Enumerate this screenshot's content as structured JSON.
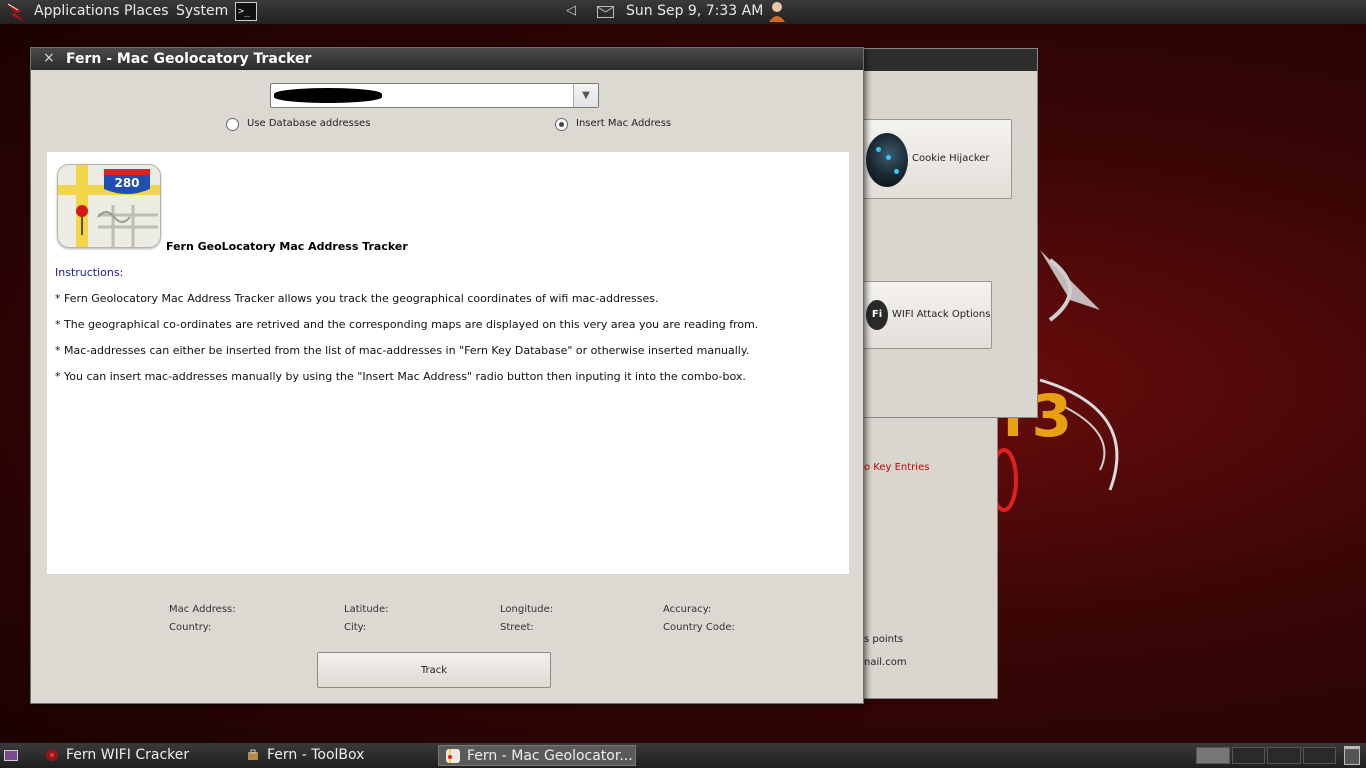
{
  "top_panel": {
    "menus": [
      "Applications",
      "Places",
      "System"
    ],
    "terminal_glyph": ">_",
    "clock": "Sun Sep  9,  7:33 AM"
  },
  "geo_window": {
    "title": "Fern - Mac Geolocatory Tracker",
    "close_glyph": "×",
    "combo_arrow": "▼",
    "radio_database": "Use Database addresses",
    "radio_insert_mac": "Insert Mac Address",
    "selected_radio": "Insert Mac Address",
    "icon_badge": "280",
    "heading": "Fern GeoLocatory Mac Address Tracker",
    "instructions_label": "Instructions:",
    "instructions": [
      "* Fern Geolocatory Mac Address Tracker allows you track the geographical coordinates of wifi mac-addresses.",
      "* The geographical co-ordinates are retrived and the corresponding maps are displayed on this very area you are reading from.",
      "* Mac-addresses can either be inserted from the list of mac-addresses in \"Fern Key Database\" or otherwise inserted manually.",
      "* You can insert mac-addresses manually by using the \"Insert Mac Address\" radio button then inputing it into the combo-box."
    ],
    "fields": {
      "mac_address": "Mac Address:",
      "latitude": "Latitude:",
      "longitude": "Longitude:",
      "accuracy": "Accuracy:",
      "country": "Country:",
      "city": "City:",
      "street": "Street:",
      "country_code": "Country Code:"
    },
    "track_button": "Track"
  },
  "toolbox_window": {
    "cookie_hijacker": "Cookie Hijacker",
    "wifi_attack_options": "WIFI Attack Options",
    "wifi_icon_text": "Fi"
  },
  "fern_window": {
    "key_entries": "o Key Entries",
    "access_points": "s points",
    "contact": "nail.com"
  },
  "background": {
    "version_text": "r3"
  },
  "taskbar": {
    "tasks": [
      "Fern WIFI Cracker",
      "Fern - ToolBox",
      "Fern - Mac Geolocator..."
    ],
    "active_task": "Fern - Mac Geolocator..."
  },
  "colors": {
    "panel_bg": "#2a2a2a",
    "window_bg": "#dcd8d2",
    "instructions_blue": "#1a1aa0",
    "key_entries_red": "#d00000",
    "desktop_red": "#5a0a0a"
  }
}
